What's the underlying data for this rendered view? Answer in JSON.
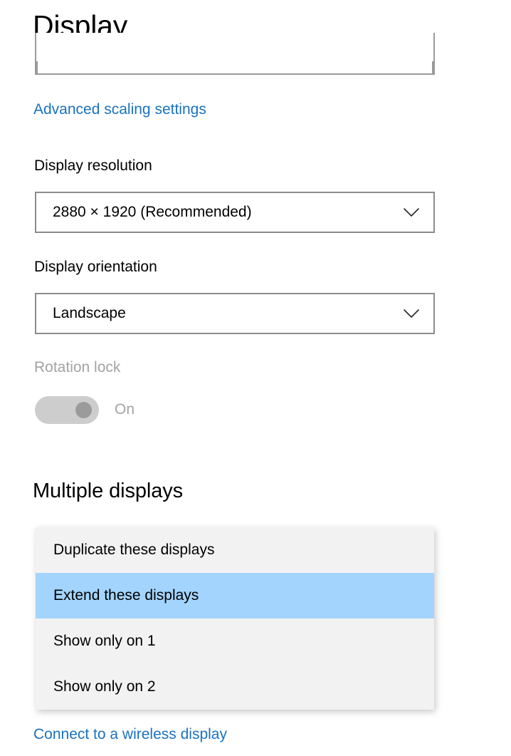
{
  "page": {
    "title": "Display"
  },
  "links": {
    "advanced_scaling": "Advanced scaling settings",
    "wireless_display": "Connect to a wireless display"
  },
  "resolution": {
    "label": "Display resolution",
    "value": "2880 × 1920 (Recommended)",
    "chevron_icon": "chevron-down-icon"
  },
  "orientation": {
    "label": "Display orientation",
    "value": "Landscape",
    "chevron_icon": "chevron-down-icon"
  },
  "rotation_lock": {
    "label": "Rotation lock",
    "state": "On",
    "enabled": false
  },
  "multiple_displays": {
    "heading": "Multiple displays",
    "options": [
      {
        "label": "Duplicate these displays",
        "selected": false
      },
      {
        "label": "Extend these displays",
        "selected": true
      },
      {
        "label": "Show only on 1",
        "selected": false
      },
      {
        "label": "Show only on 2",
        "selected": false
      }
    ]
  },
  "colors": {
    "link_blue": "#1a72c0",
    "highlight_blue": "#a3d4fd",
    "dropdown_background": "#f2f2f2",
    "disabled_text": "#a3a3a3",
    "combo_border": "#8c8c8c",
    "toggle_track": "#cdcdcd",
    "toggle_knob": "#9b9b9b"
  }
}
